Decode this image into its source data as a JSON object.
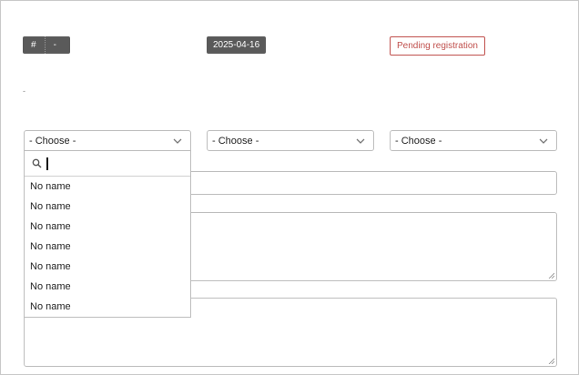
{
  "header": {
    "id_chip": {
      "hash": "#",
      "value": "-"
    },
    "date": "2025-04-16",
    "status_badge": "Pending registration",
    "note": "-"
  },
  "selects": [
    {
      "selected": "- Choose -",
      "open": true
    },
    {
      "selected": "- Choose -",
      "open": false
    },
    {
      "selected": "- Choose -",
      "open": false
    }
  ],
  "dropdown": {
    "search_value": "",
    "options": [
      "No name",
      "No name",
      "No name",
      "No name",
      "No name",
      "No name",
      "No name"
    ]
  },
  "colors": {
    "chip_bg": "#5a5a5a",
    "badge_red": "#c0504d",
    "border": "#bdbdbd"
  },
  "icons": [
    "chevron-down-icon",
    "search-icon",
    "resize-grip-icon"
  ]
}
